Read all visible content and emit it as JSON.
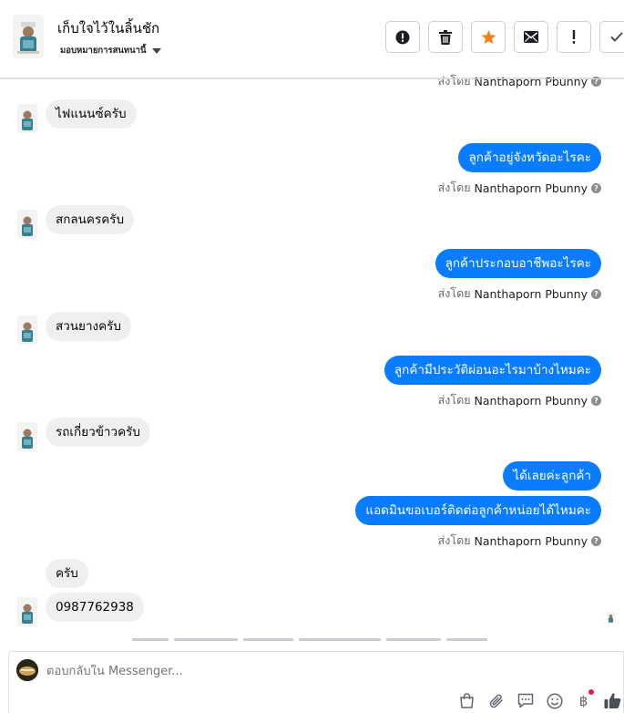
{
  "header": {
    "name": "เก็บใจไว้ในลิ้นชัก",
    "subtitle": "มอบหมายการสนทนานี้",
    "toolbar": [
      {
        "name": "report-spam-button",
        "icon": "alert-circle-icon"
      },
      {
        "name": "delete-button",
        "icon": "trash-icon"
      },
      {
        "name": "star-button",
        "icon": "star-icon"
      },
      {
        "name": "mark-unread-button",
        "icon": "envelope-icon"
      },
      {
        "name": "follow-up-button",
        "icon": "exclamation-icon"
      },
      {
        "name": "mark-done-button",
        "icon": "checkmark-icon"
      }
    ]
  },
  "messages": {
    "partial_sent_by_prefix": "ส่งโดย",
    "partial_sent_by_name": "Nanthaporn Pbunny",
    "m1": "ไฟแนนซ์ครับ",
    "m2": "ลูกค้าอยู่จังหวัดอะไรคะ",
    "m3": "สกลนครครับ",
    "m4": "ลูกค้าประกอบอาชีพอะไรคะ",
    "m5": "สวนยางครับ",
    "m6": "ลูกค้ามีประวัติผ่อนอะไรมาบ้างไหมคะ",
    "m7": "รถเกี่ยวข้าวครับ",
    "m8": "ได้เลยค่ะลูกค้า",
    "m9": "แอดมินขอเบอร์ติดต่อลูกค้าหน่อยได้ไหมคะ",
    "m10": "ครับ",
    "m11": "0987762938",
    "sent_by_prefix": "ส่งโดย",
    "sent_by_name": "Nanthaporn Pbunny"
  },
  "composer": {
    "placeholder": "ตอบกลับใน Messenger...",
    "tools": [
      "shopping-bag-icon",
      "paperclip-icon",
      "saved-reply-icon",
      "emoji-icon",
      "baht-payment-icon",
      "thumbs-up-icon"
    ],
    "baht_symbol": "฿"
  },
  "colors": {
    "outgoing_bubble": "#0a7cff",
    "incoming_bubble": "#efefef",
    "star": "#f5821f",
    "notification_dot": "#e41e3f"
  }
}
